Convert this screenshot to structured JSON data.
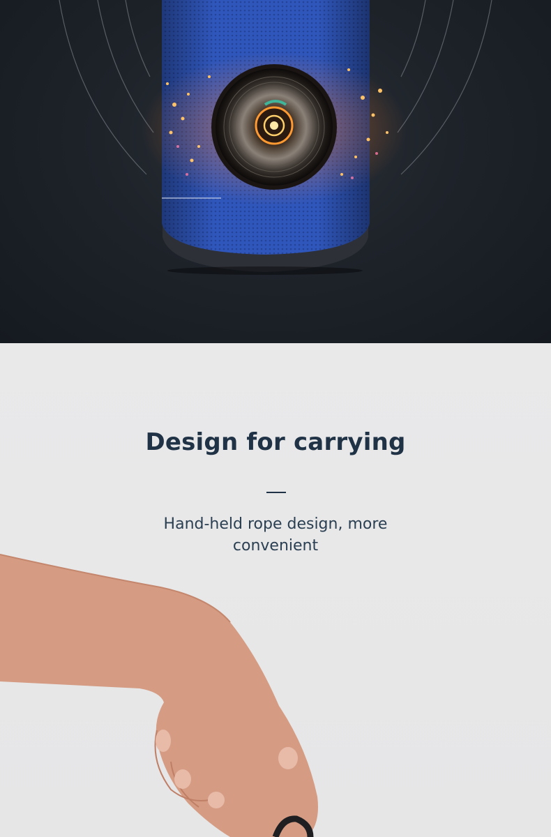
{
  "carry_section": {
    "title": "Design for carrying",
    "subtitle": "Hand-held rope design, more convenient"
  },
  "colors": {
    "hero_background": "#1c2128",
    "speaker_fabric": "#2f55b8",
    "section_background": "#e9e9ea",
    "heading_text": "#1f3246"
  },
  "images": {
    "hero": "blue-cylindrical-speaker-driver-photo",
    "carry": "hand-holding-speaker-strap-photo"
  }
}
